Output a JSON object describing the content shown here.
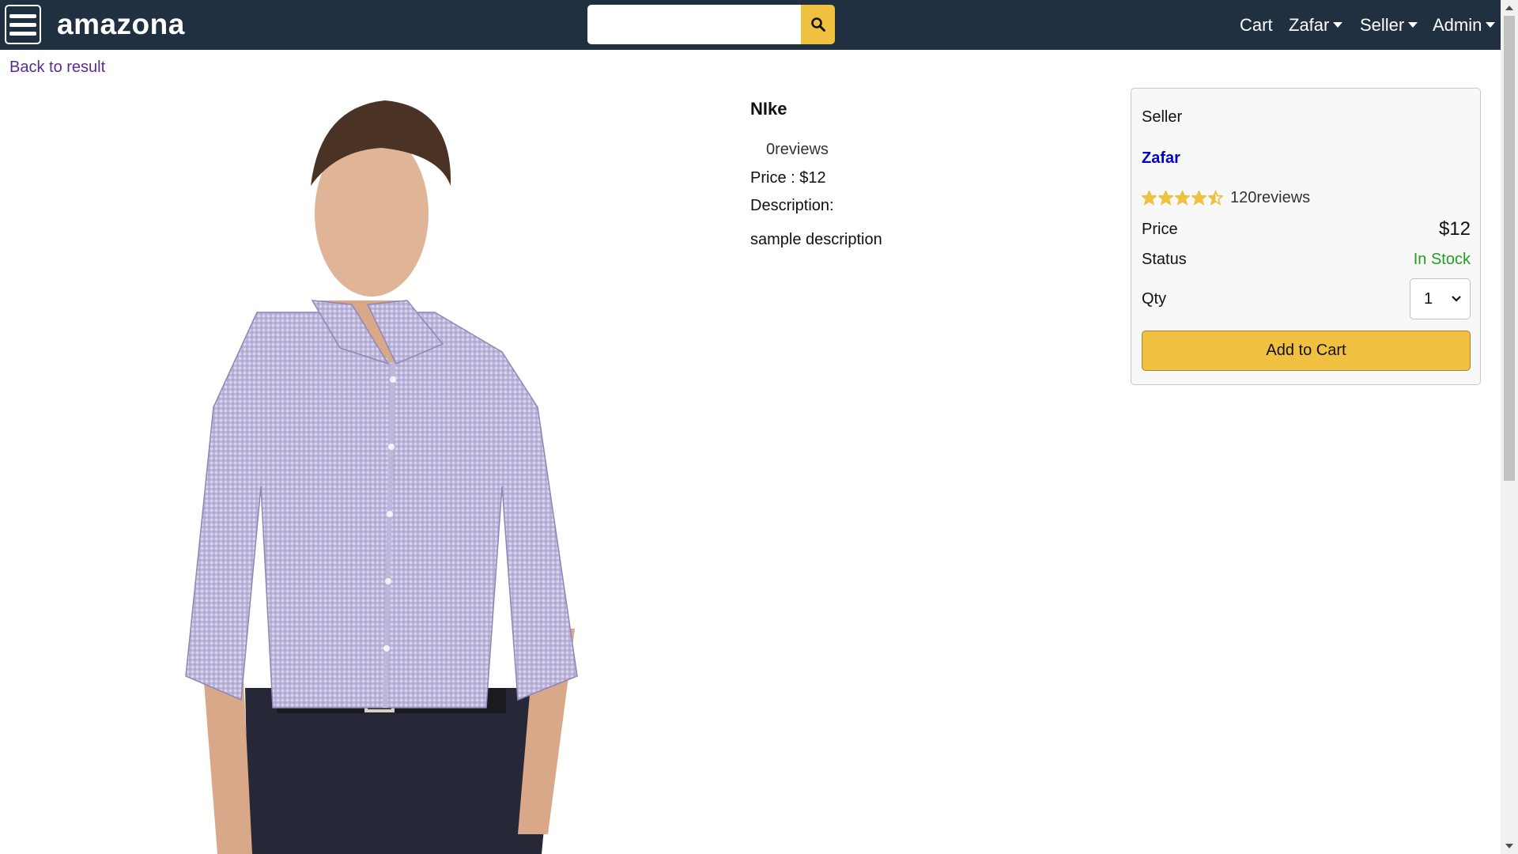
{
  "header": {
    "brand": "amazona",
    "search": {
      "value": "",
      "placeholder": ""
    },
    "nav": {
      "cart": "Cart",
      "user": "Zafar",
      "seller": "Seller",
      "admin": "Admin"
    }
  },
  "back_link": "Back to result",
  "product": {
    "name": "NIke",
    "reviews": "0reviews",
    "price_line": "Price : $12",
    "description_label": "Description:",
    "description": "sample description"
  },
  "seller_card": {
    "seller_label": "Seller",
    "seller_name": "Zafar",
    "rating": 4.5,
    "reviews": "120reviews",
    "price_label": "Price",
    "price": "$12",
    "status_label": "Status",
    "status": "In Stock",
    "qty_label": "Qty",
    "qty_value": "1",
    "add_to_cart": "Add to Cart"
  },
  "colors": {
    "header_bg": "#203040",
    "accent": "#f0c040",
    "in_stock": "#20a020",
    "seller_link": "#0000cc",
    "back_link": "#5b2c90"
  },
  "icons": [
    "menu-icon",
    "search-icon",
    "caret-down-icon",
    "star-icon",
    "star-half-icon",
    "chevron-down-icon"
  ]
}
